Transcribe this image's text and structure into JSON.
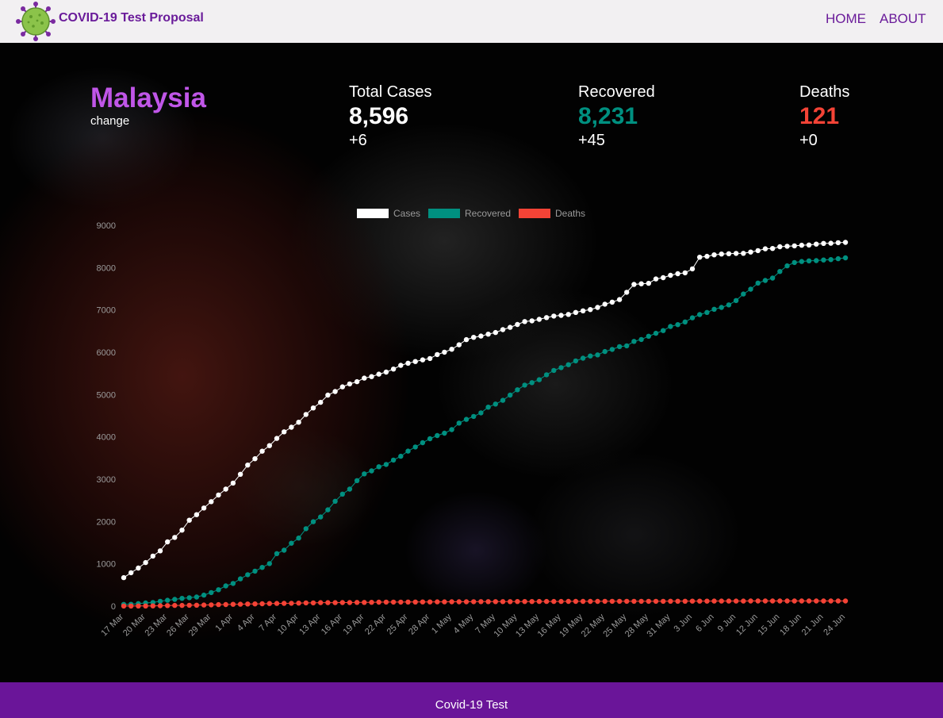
{
  "nav": {
    "brand": "COVID-19 Test Proposal",
    "home": "HOME",
    "about": "ABOUT"
  },
  "summary": {
    "country": "Malaysia",
    "change_label": "change",
    "total": {
      "label": "Total Cases",
      "value": "8,596",
      "delta": "+6"
    },
    "recovered": {
      "label": "Recovered",
      "value": "8,231",
      "delta": "+45"
    },
    "deaths": {
      "label": "Deaths",
      "value": "121",
      "delta": "+0"
    }
  },
  "colors": {
    "brand": "#6a1b9a",
    "country": "#c056e8",
    "cases": "#ffffff",
    "recovered": "#009080",
    "deaths": "#f44336",
    "footer": "#6a1599"
  },
  "chart_data": {
    "type": "line",
    "x": [
      "17 Mar",
      "18 Mar",
      "19 Mar",
      "20 Mar",
      "21 Mar",
      "22 Mar",
      "23 Mar",
      "24 Mar",
      "25 Mar",
      "26 Mar",
      "27 Mar",
      "28 Mar",
      "29 Mar",
      "30 Mar",
      "31 Mar",
      "1 Apr",
      "2 Apr",
      "3 Apr",
      "4 Apr",
      "5 Apr",
      "6 Apr",
      "7 Apr",
      "8 Apr",
      "9 Apr",
      "10 Apr",
      "11 Apr",
      "12 Apr",
      "13 Apr",
      "14 Apr",
      "15 Apr",
      "16 Apr",
      "17 Apr",
      "18 Apr",
      "19 Apr",
      "20 Apr",
      "21 Apr",
      "22 Apr",
      "23 Apr",
      "24 Apr",
      "25 Apr",
      "26 Apr",
      "27 Apr",
      "28 Apr",
      "29 Apr",
      "30 Apr",
      "1 May",
      "2 May",
      "3 May",
      "4 May",
      "5 May",
      "6 May",
      "7 May",
      "8 May",
      "9 May",
      "10 May",
      "11 May",
      "12 May",
      "13 May",
      "14 May",
      "15 May",
      "16 May",
      "17 May",
      "18 May",
      "19 May",
      "20 May",
      "21 May",
      "22 May",
      "23 May",
      "24 May",
      "25 May",
      "26 May",
      "27 May",
      "28 May",
      "29 May",
      "30 May",
      "31 May",
      "1 Jun",
      "2 Jun",
      "3 Jun",
      "4 Jun",
      "5 Jun",
      "6 Jun",
      "7 Jun",
      "8 Jun",
      "9 Jun",
      "10 Jun",
      "11 Jun",
      "12 Jun",
      "13 Jun",
      "14 Jun",
      "15 Jun",
      "16 Jun",
      "17 Jun",
      "18 Jun",
      "19 Jun",
      "20 Jun",
      "21 Jun",
      "22 Jun",
      "23 Jun",
      "24 Jun"
    ],
    "x_tick_labels": [
      "17 Mar",
      "20 Mar",
      "23 Mar",
      "26 Mar",
      "29 Mar",
      "1 Apr",
      "4 Apr",
      "7 Apr",
      "10 Apr",
      "13 Apr",
      "16 Apr",
      "19 Apr",
      "22 Apr",
      "25 Apr",
      "28 Apr",
      "1 May",
      "4 May",
      "7 May",
      "10 May",
      "13 May",
      "16 May",
      "19 May",
      "22 May",
      "25 May",
      "28 May",
      "31 May",
      "3 Jun",
      "6 Jun",
      "9 Jun",
      "12 Jun",
      "15 Jun",
      "18 Jun",
      "21 Jun",
      "24 Jun"
    ],
    "y_ticks": [
      0,
      1000,
      2000,
      3000,
      4000,
      5000,
      6000,
      7000,
      8000,
      9000
    ],
    "ylim": [
      0,
      9000
    ],
    "legend_position": "top",
    "grid": false,
    "series": [
      {
        "name": "Cases",
        "color": "#ffffff",
        "values": [
          673,
          790,
          900,
          1030,
          1183,
          1306,
          1518,
          1624,
          1796,
          2031,
          2161,
          2320,
          2470,
          2626,
          2766,
          2908,
          3116,
          3333,
          3483,
          3662,
          3793,
          3963,
          4119,
          4228,
          4346,
          4530,
          4683,
          4817,
          4987,
          5072,
          5182,
          5251,
          5305,
          5389,
          5425,
          5482,
          5532,
          5603,
          5691,
          5742,
          5780,
          5820,
          5851,
          5945,
          6002,
          6071,
          6176,
          6298,
          6353,
          6383,
          6428,
          6467,
          6535,
          6589,
          6656,
          6726,
          6742,
          6779,
          6819,
          6855,
          6872,
          6894,
          6941,
          6978,
          7009,
          7059,
          7137,
          7185,
          7245,
          7417,
          7604,
          7619,
          7629,
          7732,
          7762,
          7819,
          7857,
          7877,
          7970,
          8247,
          8266,
          8303,
          8322,
          8329,
          8336,
          8338,
          8369,
          8402,
          8445,
          8453,
          8494,
          8505,
          8515,
          8529,
          8535,
          8556,
          8572,
          8576,
          8590,
          8596
        ]
      },
      {
        "name": "Recovered",
        "color": "#009080",
        "values": [
          42,
          43,
          60,
          75,
          87,
          114,
          139,
          159,
          183,
          199,
          215,
          260,
          320,
          388,
          479,
          537,
          645,
          743,
          827,
          915,
          1005,
          1241,
          1321,
          1487,
          1608,
          1830,
          1995,
          2108,
          2276,
          2478,
          2647,
          2766,
          2967,
          3125,
          3197,
          3295,
          3349,
          3452,
          3542,
          3663,
          3762,
          3862,
          3957,
          4032,
          4087,
          4171,
          4326,
          4413,
          4484,
          4567,
          4702,
          4776,
          4864,
          4987,
          5113,
          5223,
          5281,
          5351,
          5468,
          5571,
          5636,
          5706,
          5796,
          5859,
          5912,
          5939,
          6017,
          6068,
          6134,
          6151,
          6257,
          6302,
          6379,
          6449,
          6511,
          6609,
          6652,
          6717,
          6814,
          6890,
          6942,
          7016,
          7059,
          7120,
          7222,
          7376,
          7490,
          7635,
          7697,
          7754,
          7909,
          8041,
          8121,
          8145,
          8160,
          8165,
          8180,
          8190,
          8210,
          8231
        ]
      },
      {
        "name": "Deaths",
        "color": "#f44336",
        "values": [
          2,
          2,
          3,
          3,
          5,
          10,
          14,
          16,
          17,
          20,
          23,
          26,
          30,
          35,
          37,
          43,
          45,
          50,
          53,
          57,
          61,
          63,
          65,
          67,
          72,
          76,
          77,
          82,
          82,
          83,
          84,
          85,
          88,
          89,
          90,
          93,
          95,
          96,
          96,
          98,
          98,
          100,
          100,
          102,
          102,
          103,
          103,
          104,
          105,
          106,
          107,
          107,
          107,
          107,
          108,
          108,
          109,
          110,
          111,
          111,
          111,
          112,
          113,
          113,
          113,
          113,
          114,
          114,
          115,
          115,
          115,
          115,
          115,
          115,
          115,
          116,
          116,
          117,
          118,
          119,
          119,
          120,
          120,
          120,
          120,
          120,
          121,
          121,
          121,
          121,
          121,
          121,
          121,
          121,
          121,
          121,
          121,
          121,
          121,
          121
        ]
      }
    ]
  },
  "footer": {
    "text": "Covid-19 Test"
  }
}
